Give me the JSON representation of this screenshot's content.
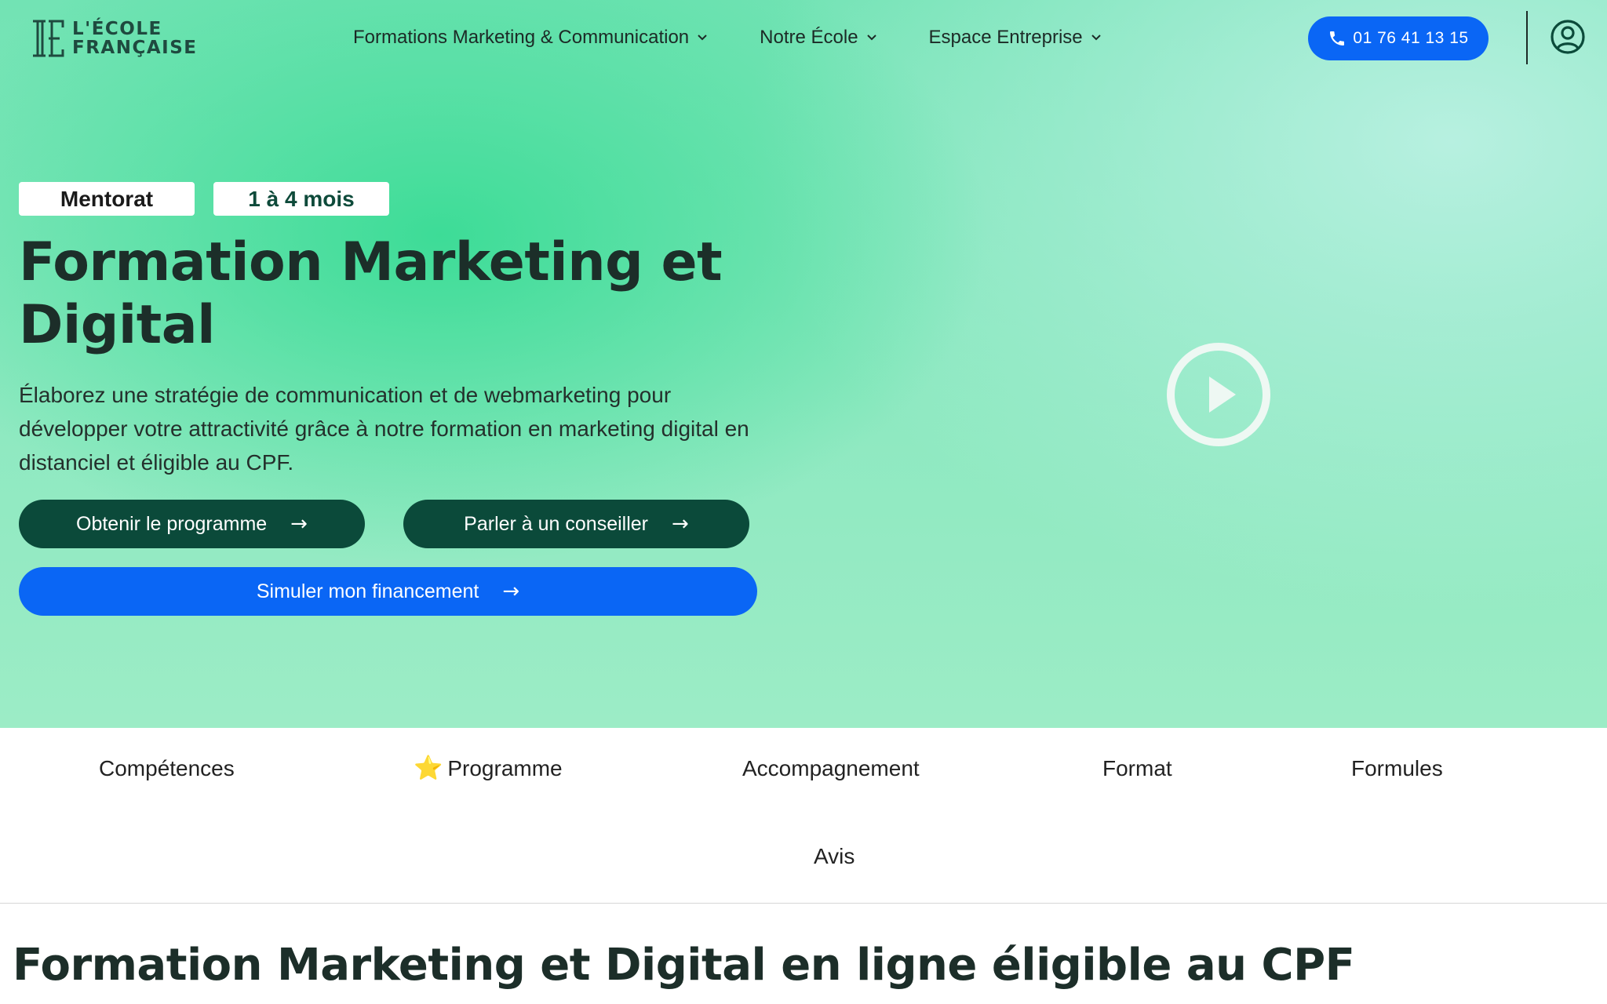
{
  "header": {
    "logo": {
      "line1": "L'ÉCOLE",
      "line2": "FRANÇAISE"
    },
    "nav": [
      {
        "label": "Formations Marketing & Communication"
      },
      {
        "label": "Notre École"
      },
      {
        "label": "Espace Entreprise"
      }
    ],
    "phone": {
      "label": "01 76 41 13 15"
    }
  },
  "hero": {
    "badges": [
      "Mentorat",
      "1 à 4 mois"
    ],
    "title": "Formation Marketing et Digital",
    "description": "Élaborez une stratégie de communication et de webmarketing pour développer votre attractivité grâce à notre formation en marketing digital en distanciel et éligible au CPF.",
    "buttons": {
      "programme": "Obtenir le programme",
      "conseiller": "Parler à un conseiller",
      "financement": "Simuler mon financement",
      "arrow": "→"
    }
  },
  "tabs": [
    {
      "label": "Compétences"
    },
    {
      "label": "Programme",
      "icon": "star-icon",
      "star": "⭐"
    },
    {
      "label": "Accompagnement"
    },
    {
      "label": "Format"
    },
    {
      "label": "Formules"
    },
    {
      "label": "Avis"
    }
  ],
  "section": {
    "title": "Formation Marketing et Digital en ligne éligible au CPF"
  },
  "colors": {
    "accent_blue": "#0a66f5",
    "dark_green": "#0b4a3a",
    "hero_green": "#3ddc97"
  }
}
